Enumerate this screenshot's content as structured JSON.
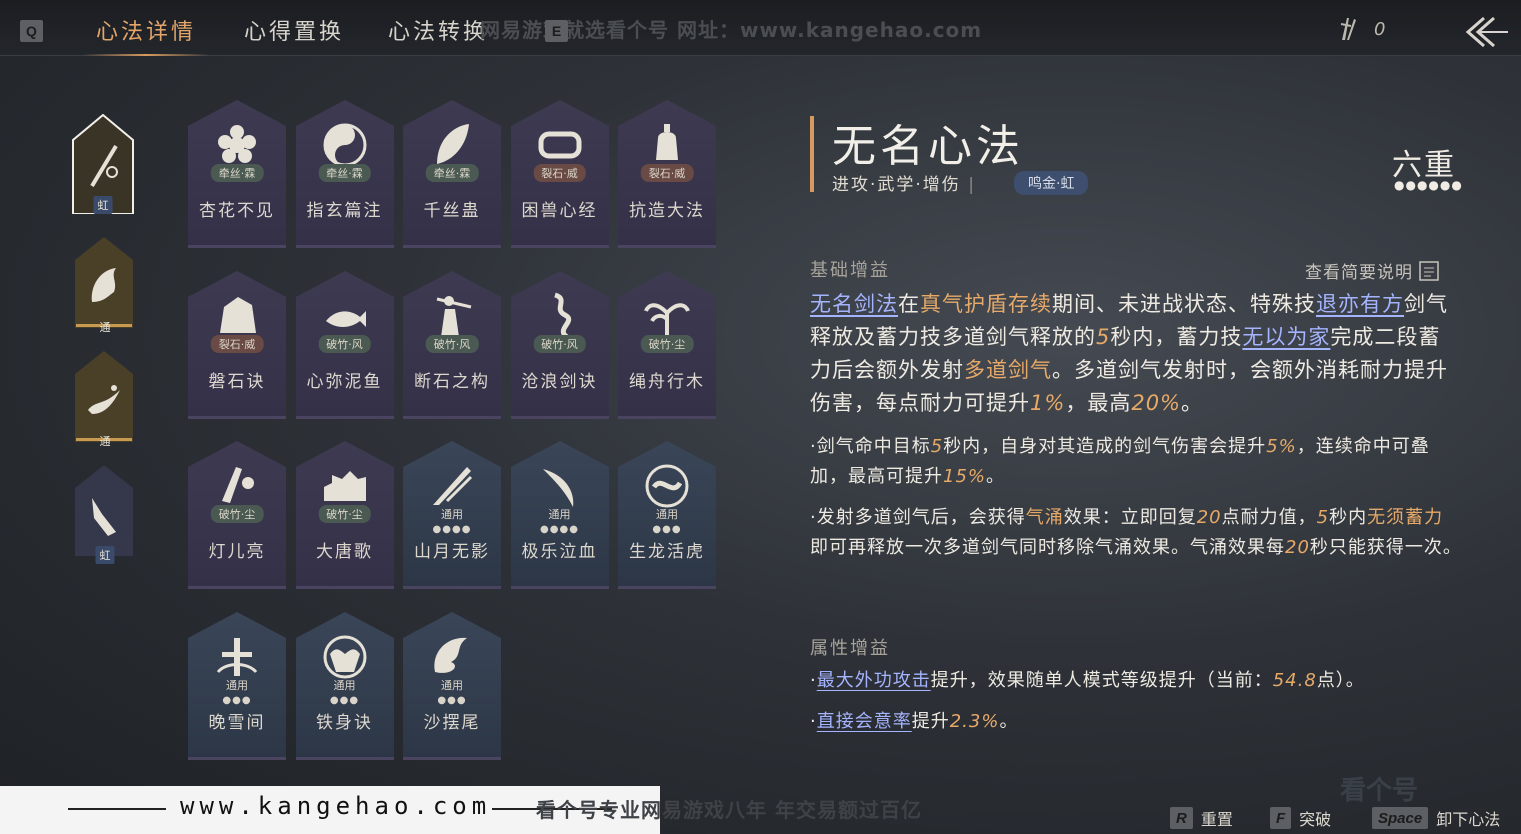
{
  "topbar": {
    "key_q": "Q",
    "key_e": "E",
    "tabs": [
      {
        "label": "心法详情",
        "active": true
      },
      {
        "label": "心得置换",
        "active": false
      },
      {
        "label": "心法转换",
        "active": false
      }
    ],
    "watermark": "网易游戏就选看个号  网址：www.kangehao.com",
    "currency_value": "0"
  },
  "rail": [
    {
      "badge": "虹",
      "icon": "sword-icon",
      "selected": true
    },
    {
      "badge": "通",
      "icon": "horse-icon",
      "selected": false
    },
    {
      "badge": "通",
      "icon": "crane-icon",
      "selected": false
    },
    {
      "badge": "虹",
      "icon": "arm-icon",
      "selected": false
    }
  ],
  "cards": [
    {
      "name": "杏花不见",
      "tag": "牵丝·霖",
      "tag_type": "blue",
      "icon": "flower-icon",
      "tone": "purple",
      "dots": ""
    },
    {
      "name": "指玄篇注",
      "tag": "牵丝·霖",
      "tag_type": "blue",
      "icon": "taichi-icon",
      "tone": "purple",
      "dots": ""
    },
    {
      "name": "千丝蛊",
      "tag": "牵丝·霖",
      "tag_type": "blue",
      "icon": "leaf-icon",
      "tone": "purple",
      "dots": ""
    },
    {
      "name": "困兽心经",
      "tag": "裂石·威",
      "tag_type": "red",
      "icon": "collar-icon",
      "tone": "purple",
      "dots": ""
    },
    {
      "name": "抗造大法",
      "tag": "裂石·威",
      "tag_type": "red",
      "icon": "bell-icon",
      "tone": "purple",
      "dots": ""
    },
    {
      "name": "磐石诀",
      "tag": "裂石·威",
      "tag_type": "red",
      "icon": "rock-icon",
      "tone": "purple",
      "dots": ""
    },
    {
      "name": "心弥泥鱼",
      "tag": "破竹·风",
      "tag_type": "blue",
      "icon": "fish-icon",
      "tone": "purple",
      "dots": ""
    },
    {
      "name": "断石之构",
      "tag": "破竹·风",
      "tag_type": "blue",
      "icon": "warrior-icon",
      "tone": "purple",
      "dots": ""
    },
    {
      "name": "沧浪剑诀",
      "tag": "破竹·风",
      "tag_type": "blue",
      "icon": "dragon-icon",
      "tone": "purple",
      "dots": ""
    },
    {
      "name": "绳舟行木",
      "tag": "破竹·尘",
      "tag_type": "blue",
      "icon": "tree-icon",
      "tone": "purple",
      "dots": ""
    },
    {
      "name": "灯儿亮",
      "tag": "破竹·尘",
      "tag_type": "blue",
      "icon": "lantern-icon",
      "tone": "purple",
      "dots": ""
    },
    {
      "name": "大唐歌",
      "tag": "破竹·尘",
      "tag_type": "blue",
      "icon": "city-icon",
      "tone": "purple",
      "dots": ""
    },
    {
      "name": "山月无影",
      "tag": "通用",
      "tag_type": "plain",
      "icon": "slash-icon",
      "tone": "blue",
      "dots": "●●●●"
    },
    {
      "name": "极乐泣血",
      "tag": "通用",
      "tag_type": "plain",
      "icon": "blade-icon",
      "tone": "blue",
      "dots": "●●●●"
    },
    {
      "name": "生龙活虎",
      "tag": "通用",
      "tag_type": "plain",
      "icon": "swirl-icon",
      "tone": "blue",
      "dots": "●●●"
    },
    {
      "name": "晚雪间",
      "tag": "通用",
      "tag_type": "plain",
      "icon": "cross-icon",
      "tone": "blue",
      "dots": "●●●"
    },
    {
      "name": "铁身诀",
      "tag": "通用",
      "tag_type": "plain",
      "icon": "muscle-icon",
      "tone": "blue",
      "dots": "●●●"
    },
    {
      "name": "沙摆尾",
      "tag": "通用",
      "tag_type": "plain",
      "icon": "tail-icon",
      "tone": "blue",
      "dots": "●●●"
    }
  ],
  "detail": {
    "title": "无名心法",
    "subtitle": "进攻·武学·增伤",
    "chip": "鸣金·虹",
    "tier": "六重",
    "tier_dots": "●●●●●●",
    "base_label": "基础增益",
    "view_link": "查看简要说明",
    "main_desc": {
      "p1": "无名剑法",
      "p2": "在",
      "p3": "真气护盾存续",
      "p4": "期间、未进战状态、特殊技",
      "p5": "退亦有方",
      "p6": "剑气释放及蓄力技多道剑气释放的",
      "p7": "5",
      "p8": "秒内，蓄力技",
      "p9": "无以为家",
      "p10": "完成二段蓄力后会额外发射",
      "p11": "多道剑气",
      "p12": "。多道剑气发射时，会额外消耗耐力提升伤害，每点耐力可提升",
      "p13": "1%",
      "p14": "，最高",
      "p15": "20%",
      "p16": "。"
    },
    "bullet1": {
      "a": "·剑气命中目标",
      "b": "5",
      "c": "秒内，自身对其造成的剑气伤害会提升",
      "d": "5%",
      "e": "，连续命中可叠加，最高可提升",
      "f": "15%",
      "g": "。"
    },
    "bullet2": {
      "a": "·发射多道剑气后，会获得",
      "b": "气涌",
      "c": "效果：立即回复",
      "d": "20",
      "e": "点耐力值，",
      "f": "5",
      "g": "秒内",
      "h": "无须蓄力",
      "i": "即可再释放一次多道剑气同时移除气涌效果。气涌效果每",
      "j": "20",
      "k": "秒只能获得一次。"
    },
    "attr_label": "属性增益",
    "attr1": {
      "a": "·",
      "b": "最大外功攻击",
      "c": "提升，效果随单人模式等级提升（当前：",
      "d": "54.8",
      "e": "点）。"
    },
    "attr2": {
      "a": "·",
      "b": "直接会意率",
      "c": "提升",
      "d": "2.3%",
      "e": "。"
    }
  },
  "bottom": {
    "site": "www.kangehao.com",
    "watermark": "看个号专业网易游戏八年  年交易额过百亿",
    "hints": [
      {
        "key": "R",
        "label": "重置"
      },
      {
        "key": "F",
        "label": "突破"
      },
      {
        "key": "Space",
        "label": "卸下心法"
      }
    ],
    "corner_logo": "看个号"
  }
}
